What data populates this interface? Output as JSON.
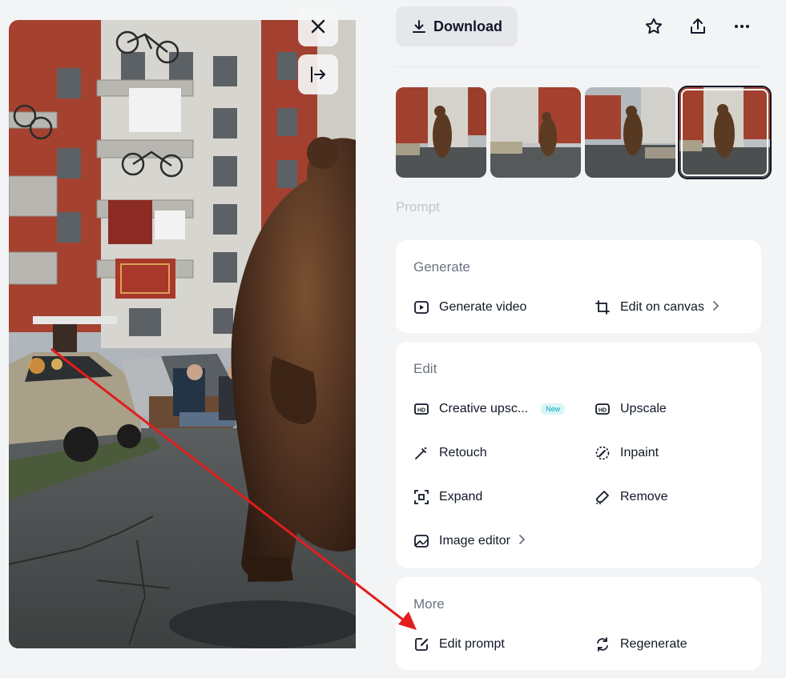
{
  "toolbar": {
    "download_label": "Download"
  },
  "section_labels": {
    "prompt": "Prompt"
  },
  "generate": {
    "title": "Generate",
    "generate_video": "Generate video",
    "edit_on_canvas": "Edit on canvas"
  },
  "edit": {
    "title": "Edit",
    "creative_upscale": "Creative upsc...",
    "new_badge": "New",
    "upscale": "Upscale",
    "retouch": "Retouch",
    "inpaint": "Inpaint",
    "expand": "Expand",
    "remove": "Remove",
    "image_editor": "Image editor"
  },
  "more": {
    "title": "More",
    "edit_prompt": "Edit prompt",
    "regenerate": "Regenerate"
  },
  "icons": {
    "close": "close-icon",
    "expand_panel": "arrow-bar-right-icon",
    "download": "download-icon",
    "favorite": "star-icon",
    "share": "share-icon",
    "more": "more-horizontal-icon"
  },
  "colors": {
    "annotation_arrow": "#e11d1d",
    "badge_text": "#0ea5b7",
    "badge_bg": "#d9f5f8"
  },
  "thumbnails": {
    "count": 4,
    "selected_index": 3
  }
}
